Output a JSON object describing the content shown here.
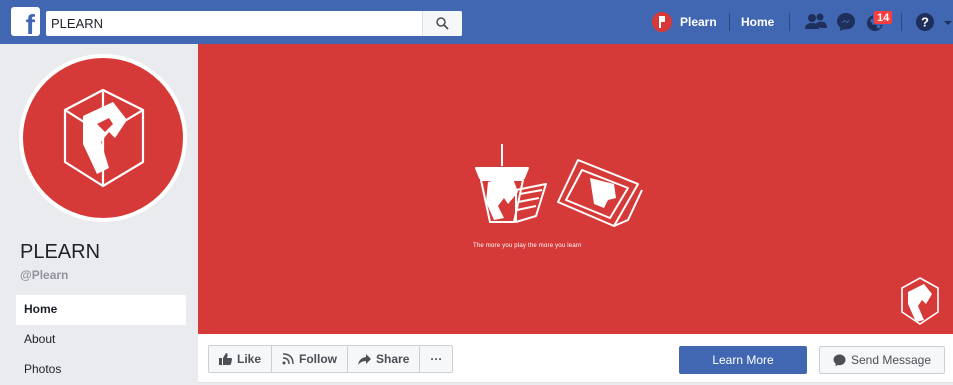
{
  "header": {
    "logo": "f",
    "search_value": "PLEARN",
    "profile_name": "Plearn",
    "home_label": "Home",
    "notification_count": "14"
  },
  "page": {
    "name": "PLEARN",
    "handle": "@Plearn"
  },
  "sidebar": {
    "items": [
      {
        "label": "Home",
        "active": true
      },
      {
        "label": "About",
        "active": false
      },
      {
        "label": "Photos",
        "active": false
      }
    ]
  },
  "cover": {
    "tagline": "The more you play the more you learn",
    "color": "#d63a38"
  },
  "actions": {
    "like": "Like",
    "follow": "Follow",
    "share": "Share",
    "more": "···",
    "learn_more": "Learn More",
    "send_message": "Send Message"
  },
  "colors": {
    "brand": "#4267b2",
    "accent": "#d63a38",
    "badge": "#fa3e3e"
  }
}
